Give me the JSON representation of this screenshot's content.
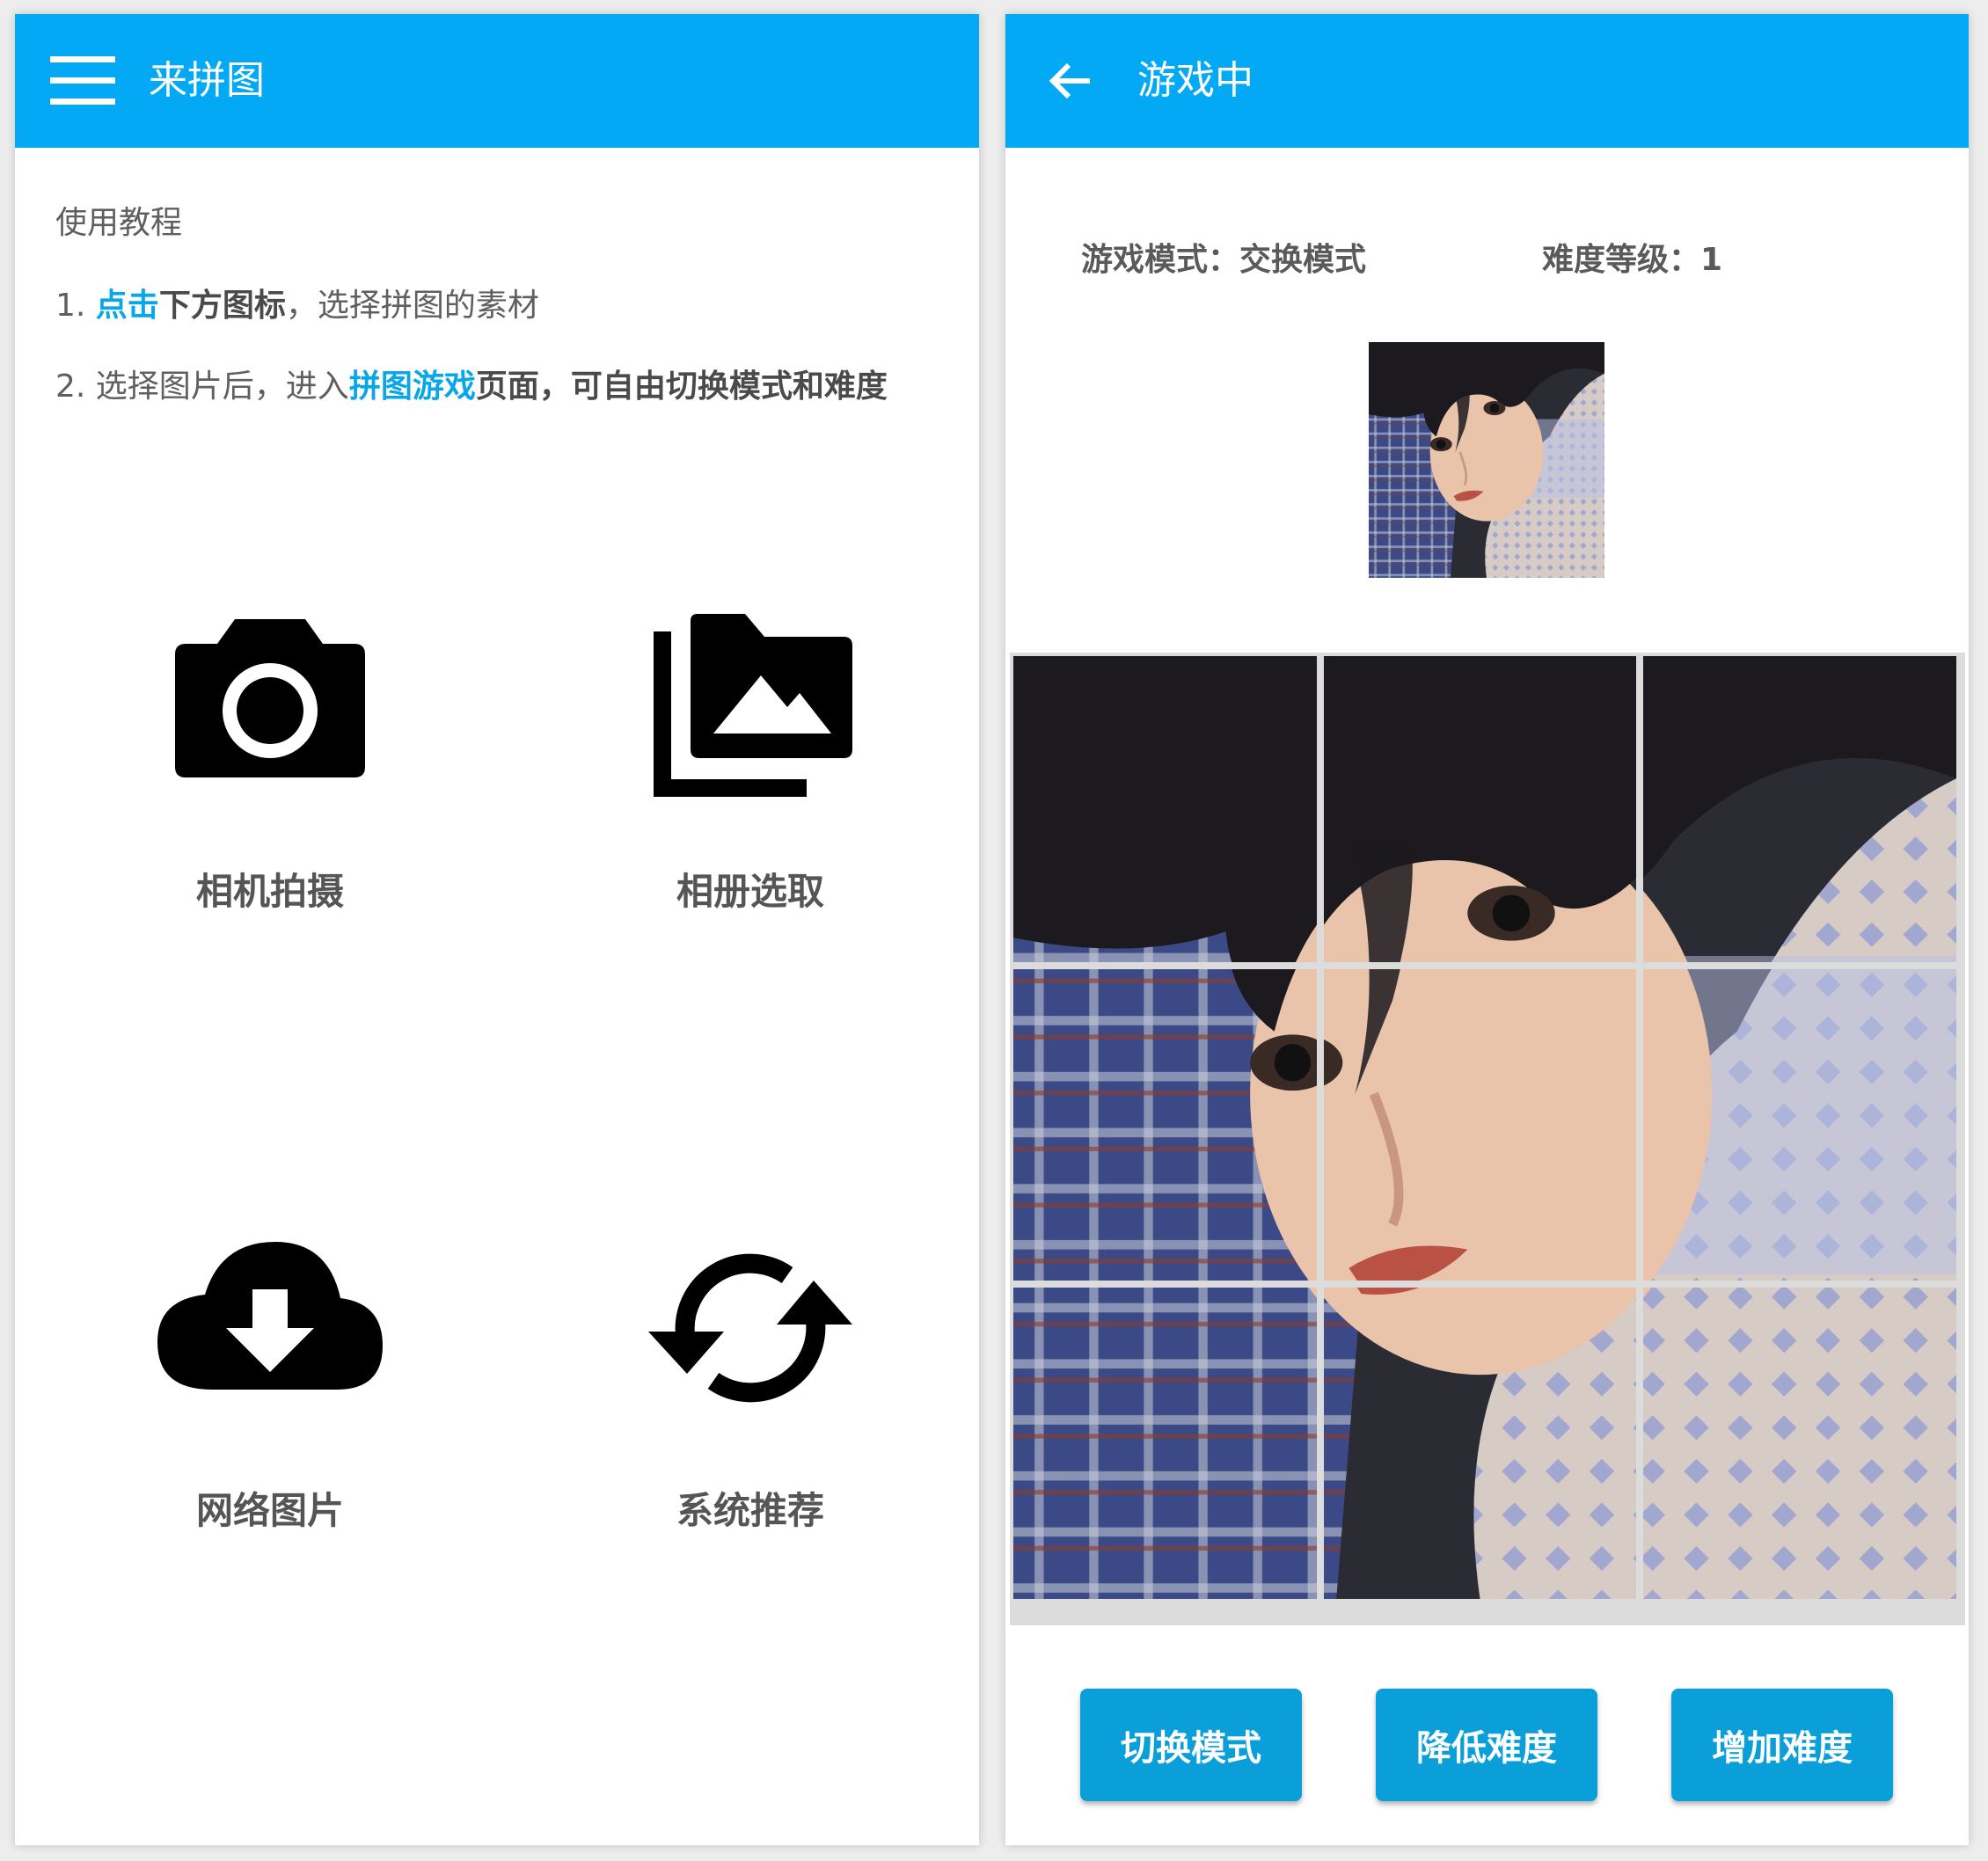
{
  "home": {
    "title": "来拼图",
    "tutorial_title": "使用教程",
    "step1": {
      "num": "1. ",
      "highlight": "点击",
      "bold": "下方图标",
      "rest": "，选择拼图的素材"
    },
    "step2": {
      "num": "2. ",
      "plain": "选择图片后，进入",
      "highlight": "拼图游戏",
      "bold": "页面，可自由切换模式和难度"
    },
    "tiles": [
      {
        "label": "相机拍摄",
        "icon": "camera-icon"
      },
      {
        "label": "相册选取",
        "icon": "photo-library-icon"
      },
      {
        "label": "网络图片",
        "icon": "cloud-download-icon"
      },
      {
        "label": "系统推荐",
        "icon": "sync-icon"
      }
    ]
  },
  "game": {
    "title": "游戏中",
    "mode_label": "游戏模式：",
    "mode_value": "交换模式",
    "level_label": "难度等级：",
    "level_value": "1",
    "grid": {
      "rows": 3,
      "cols": 3
    },
    "buttons": {
      "switch_mode": "切换模式",
      "decrease": "降低难度",
      "increase": "增加难度"
    }
  },
  "colors": {
    "appbar": "#03a9f4",
    "highlight": "#0aa7e8",
    "button": "#0a9fd8"
  }
}
